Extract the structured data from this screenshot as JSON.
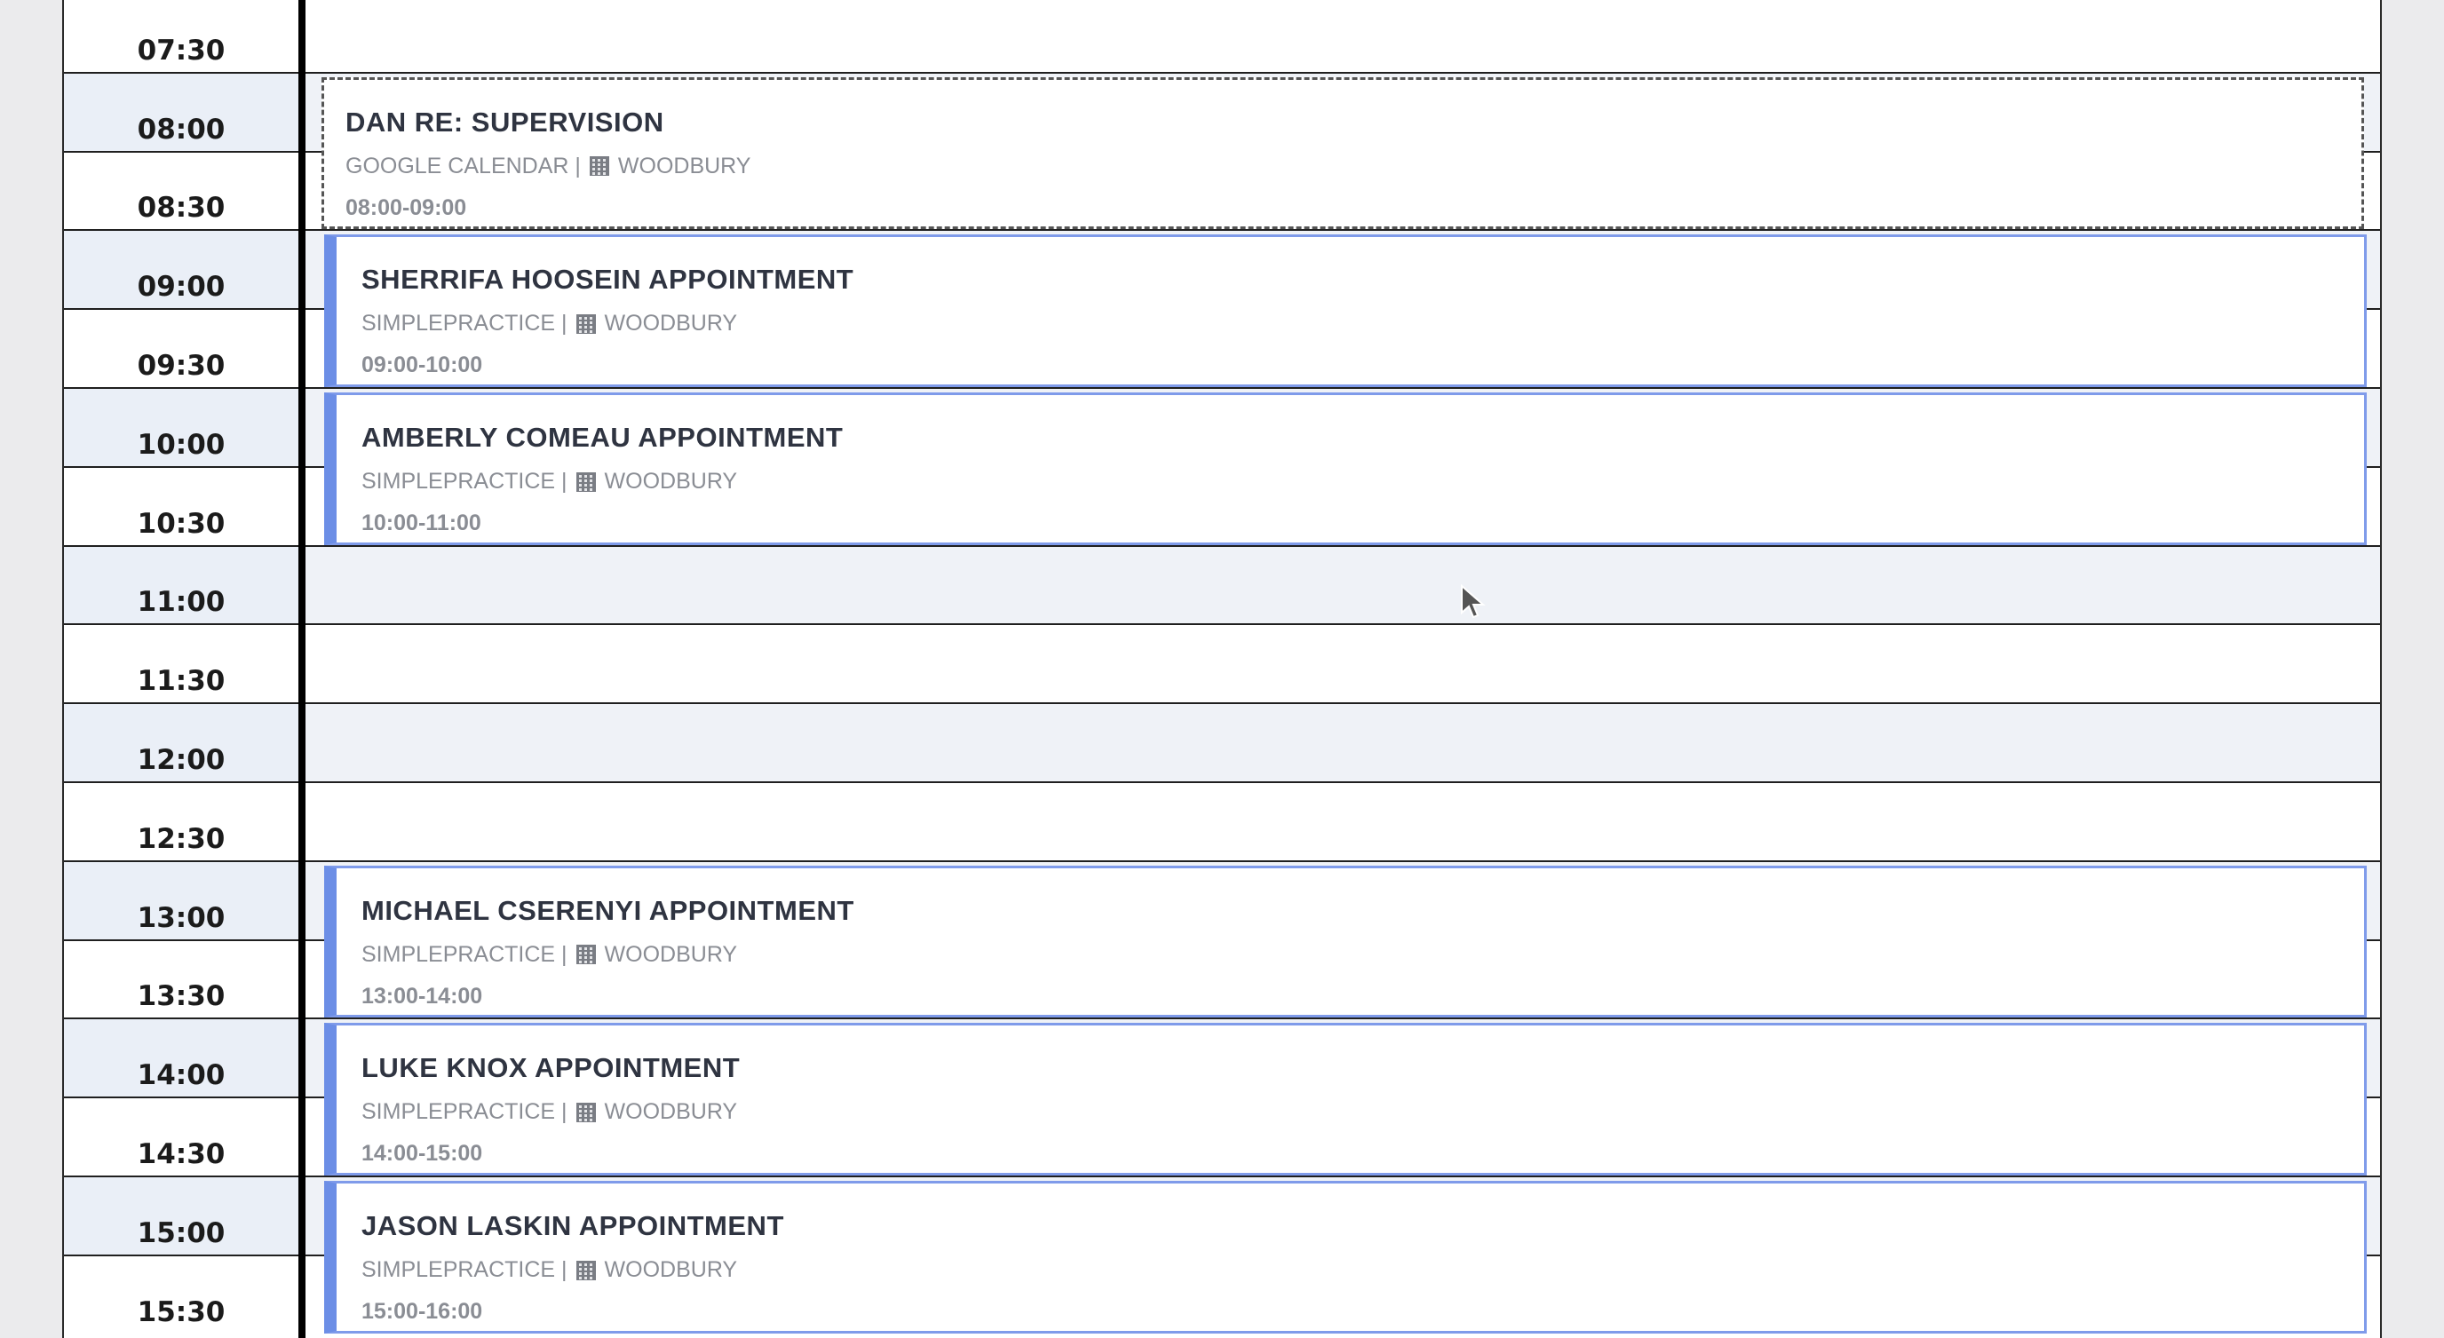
{
  "slots": [
    {
      "time": "07:30",
      "shade": false
    },
    {
      "time": "08:00",
      "shade": true
    },
    {
      "time": "08:30",
      "shade": false
    },
    {
      "time": "09:00",
      "shade": true
    },
    {
      "time": "09:30",
      "shade": false
    },
    {
      "time": "10:00",
      "shade": true
    },
    {
      "time": "10:30",
      "shade": false
    },
    {
      "time": "11:00",
      "shade": true
    },
    {
      "time": "11:30",
      "shade": false
    },
    {
      "time": "12:00",
      "shade": true
    },
    {
      "time": "12:30",
      "shade": false
    },
    {
      "time": "13:00",
      "shade": true
    },
    {
      "time": "13:30",
      "shade": false
    },
    {
      "time": "14:00",
      "shade": true
    },
    {
      "time": "14:30",
      "shade": false
    },
    {
      "time": "15:00",
      "shade": true
    },
    {
      "time": "15:30",
      "shade": false
    }
  ],
  "events": [
    {
      "title": "DAN RE: SUPERVISION",
      "source": "GOOGLE CALENDAR |",
      "location": "WOODBURY",
      "range": "08:00-09:00",
      "style": "dashed",
      "icon": "building-icon"
    },
    {
      "title": "SHERRIFA HOOSEIN APPOINTMENT",
      "source": "SIMPLEPRACTICE |",
      "location": "WOODBURY",
      "range": "09:00-10:00",
      "style": "solid",
      "icon": "building-icon"
    },
    {
      "title": "AMBERLY COMEAU APPOINTMENT",
      "source": "SIMPLEPRACTICE |",
      "location": "WOODBURY",
      "range": "10:00-11:00",
      "style": "solid",
      "icon": "building-icon"
    },
    {
      "title": "MICHAEL CSERENYI APPOINTMENT",
      "source": "SIMPLEPRACTICE |",
      "location": "WOODBURY",
      "range": "13:00-14:00",
      "style": "solid",
      "icon": "building-icon"
    },
    {
      "title": "LUKE KNOX APPOINTMENT",
      "source": "SIMPLEPRACTICE |",
      "location": "WOODBURY",
      "range": "14:00-15:00",
      "style": "solid",
      "icon": "building-icon"
    },
    {
      "title": "JASON LASKIN APPOINTMENT",
      "source": "SIMPLEPRACTICE |",
      "location": "WOODBURY",
      "range": "15:00-16:00",
      "style": "solid",
      "icon": "building-icon"
    }
  ],
  "colors": {
    "accent": "#6c8ee6",
    "shade": "#eff2f7",
    "meta_text": "#8a8d94"
  }
}
